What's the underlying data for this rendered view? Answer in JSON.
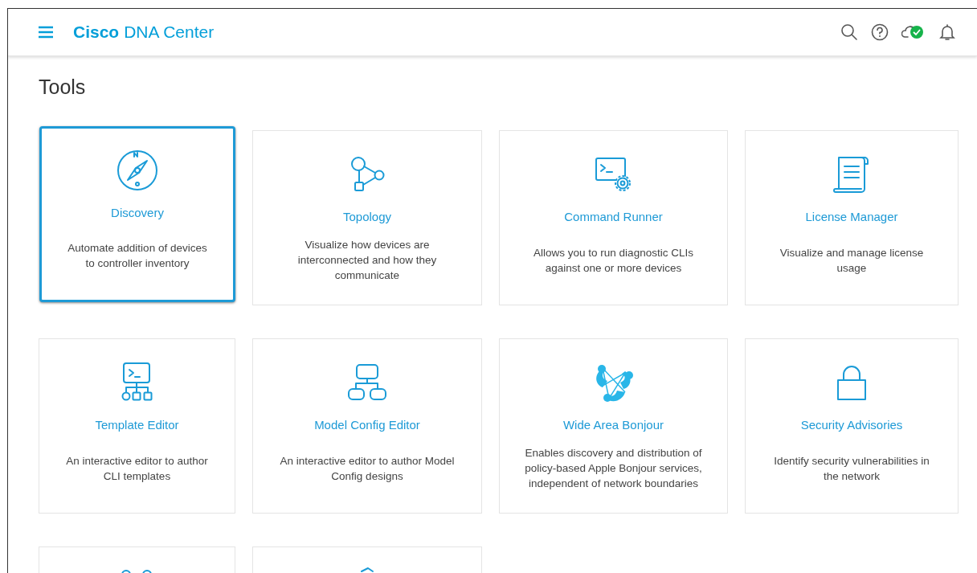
{
  "header": {
    "brand": "Cisco",
    "product": "DNA Center",
    "cloud_connected": true
  },
  "page_title": "Tools",
  "tools": [
    {
      "title": "Discovery",
      "description": "Automate addition of devices to controller inventory",
      "selected": true
    },
    {
      "title": "Topology",
      "description": "Visualize how devices are interconnected and how they communicate",
      "selected": false
    },
    {
      "title": "Command Runner",
      "description": "Allows you to run diagnostic CLIs against one or more devices",
      "selected": false
    },
    {
      "title": "License Manager",
      "description": "Visualize and manage license usage",
      "selected": false
    },
    {
      "title": "Template Editor",
      "description": "An interactive editor to author CLI templates",
      "selected": false
    },
    {
      "title": "Model Config Editor",
      "description": "An interactive editor to author Model Config designs",
      "selected": false
    },
    {
      "title": "Wide Area Bonjour",
      "description": "Enables discovery and distribution of policy-based Apple Bonjour services, independent of network boundaries",
      "selected": false
    },
    {
      "title": "Security Advisories",
      "description": "Identify security vulnerabilities in the network",
      "selected": false
    },
    {
      "selected": false
    },
    {
      "selected": false
    }
  ]
}
